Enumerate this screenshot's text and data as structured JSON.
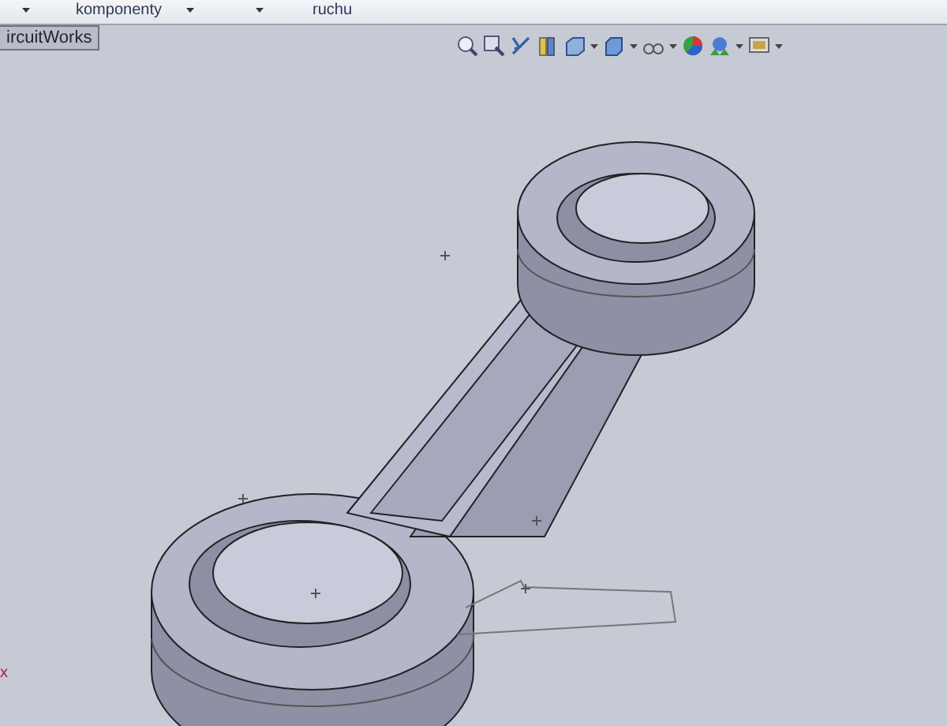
{
  "ribbon": {
    "items": [
      {
        "kind": "caret"
      },
      {
        "kind": "label",
        "text": "komponenty"
      },
      {
        "kind": "caret"
      },
      {
        "kind": "caret"
      },
      {
        "kind": "label",
        "text": "ruchu"
      }
    ]
  },
  "tabs": [
    {
      "label": "ircuitWorks",
      "selected": true
    }
  ],
  "axis_label": "x"
}
